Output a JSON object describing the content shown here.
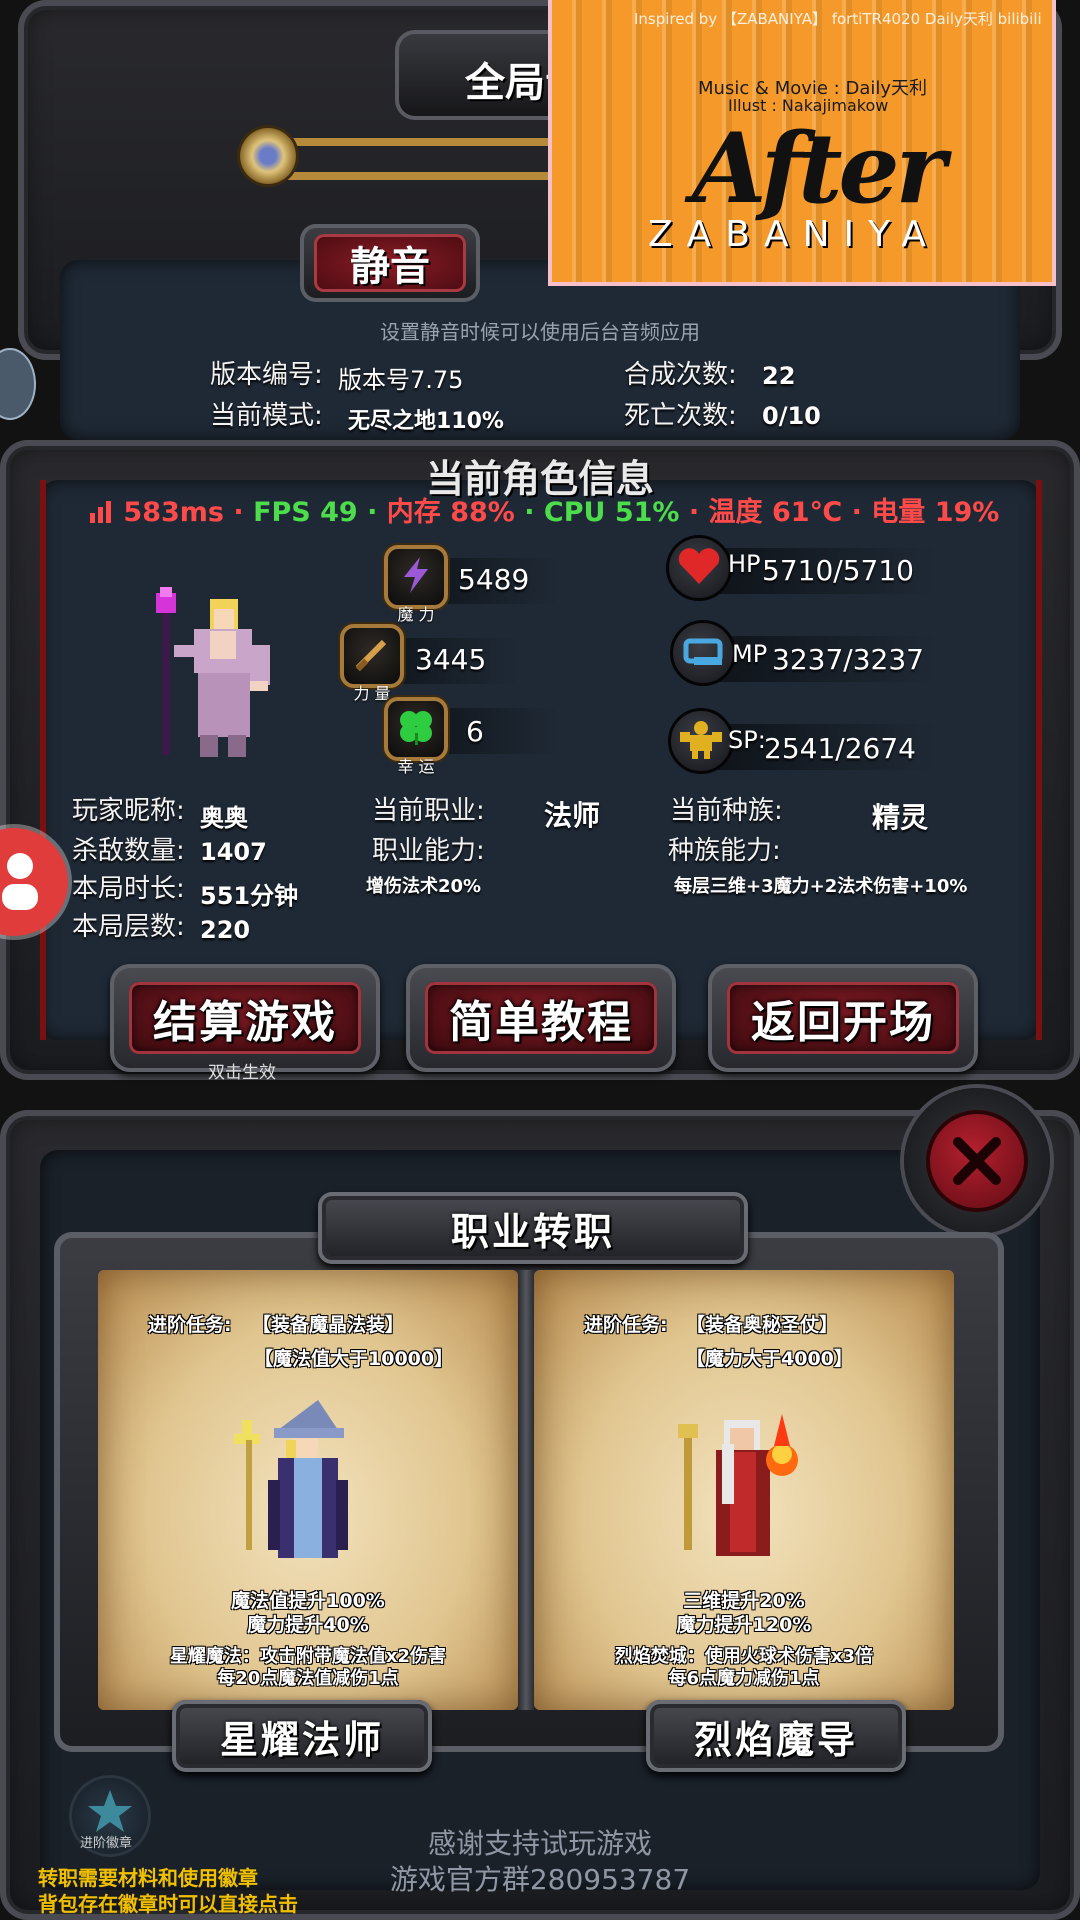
{
  "settings_panel": {
    "title": "全局音",
    "mute_button": "静音",
    "mute_hint": "设置静音时候可以使用后台音频应用"
  },
  "game_info": {
    "version_label": "版本编号:",
    "version_value": "版本号7.75",
    "mode_label": "当前模式:",
    "mode_value": "无尽之地110%",
    "craft_label": "合成次数:",
    "craft_value": "22",
    "death_label": "死亡次数:",
    "death_value": "0/10"
  },
  "character": {
    "section_title": "当前角色信息",
    "magic_label": "魔 力",
    "magic_value": "5489",
    "strength_label": "力 量",
    "strength_value": "3445",
    "luck_label": "幸 运",
    "luck_value": "6",
    "hp_label": "HP",
    "hp_value": "5710/5710",
    "mp_label": "MP",
    "mp_value": "3237/3237",
    "sp_label": "SP:",
    "sp_value": "2541/2674",
    "nickname_label": "玩家昵称:",
    "nickname_value": "奥奥",
    "kills_label": "杀敌数量:",
    "kills_value": "1407",
    "time_label": "本局时长:",
    "time_value": "551分钟",
    "floor_label": "本局层数:",
    "floor_value": "220",
    "job_label": "当前职业:",
    "job_value": "法师",
    "job_ability_label": "职业能力:",
    "job_ability_value": "增伤法术20%",
    "race_label": "当前种族:",
    "race_value": "精灵",
    "race_ability_label": "种族能力:",
    "race_ability_value": "每层三维+3魔力+2法术伤害+10%"
  },
  "perf_overlay": {
    "ping": "583ms",
    "sep": "·",
    "fps": "FPS 49",
    "mem": "内存 88%",
    "cpu": "CPU 51%",
    "temp": "温度 61℃",
    "battery": "电量 19%",
    "colors": {
      "ping": "#ff4a4a",
      "fps": "#4cdc4c",
      "mem": "#ff4a4a",
      "cpu": "#4cdc4c",
      "temp": "#ff4a4a",
      "battery": "#ff4a4a"
    }
  },
  "buttons": {
    "settle": "结算游戏",
    "settle_hint": "双击生效",
    "tutorial": "简单教程",
    "back": "返回开场"
  },
  "class_change": {
    "title": "职业转职",
    "options": [
      {
        "task_label": "进阶任务:",
        "task_1": "【装备魔晶法装】",
        "task_2": "【魔法值大于10000】",
        "bonus_1": "魔法值提升100%",
        "bonus_2": "魔力提升40%",
        "skill_1": "星耀魔法：攻击附带魔法值x2伤害",
        "skill_2": "每20点魔法值减伤1点",
        "name": "星耀法师"
      },
      {
        "task_label": "进阶任务:",
        "task_1": "【装备奥秘圣仗】",
        "task_2": "【魔力大于4000】",
        "bonus_1": "三维提升20%",
        "bonus_2": "魔力提升120%",
        "skill_1": "烈焰焚城：使用火球术伤害x3倍",
        "skill_2": "每6点魔力减伤1点",
        "name": "烈焰魔导"
      }
    ]
  },
  "badge": {
    "label": "进阶徽章"
  },
  "footer": {
    "thanks": "感谢支持试玩游戏",
    "group": "游戏官方群280953787",
    "tip_1": "转职需要材料和使用徽章",
    "tip_2": "背包存在徽章时可以直接点击"
  },
  "video_overlay": {
    "credit": "Inspired by 【ZABANIYA】 fortiTR4020 Daily天利 bilibili",
    "music": "Music & Movie : Daily天利",
    "illust": "Illust : Nakajimakow",
    "logo": "After",
    "logo_sub": "ZABANIYA"
  }
}
